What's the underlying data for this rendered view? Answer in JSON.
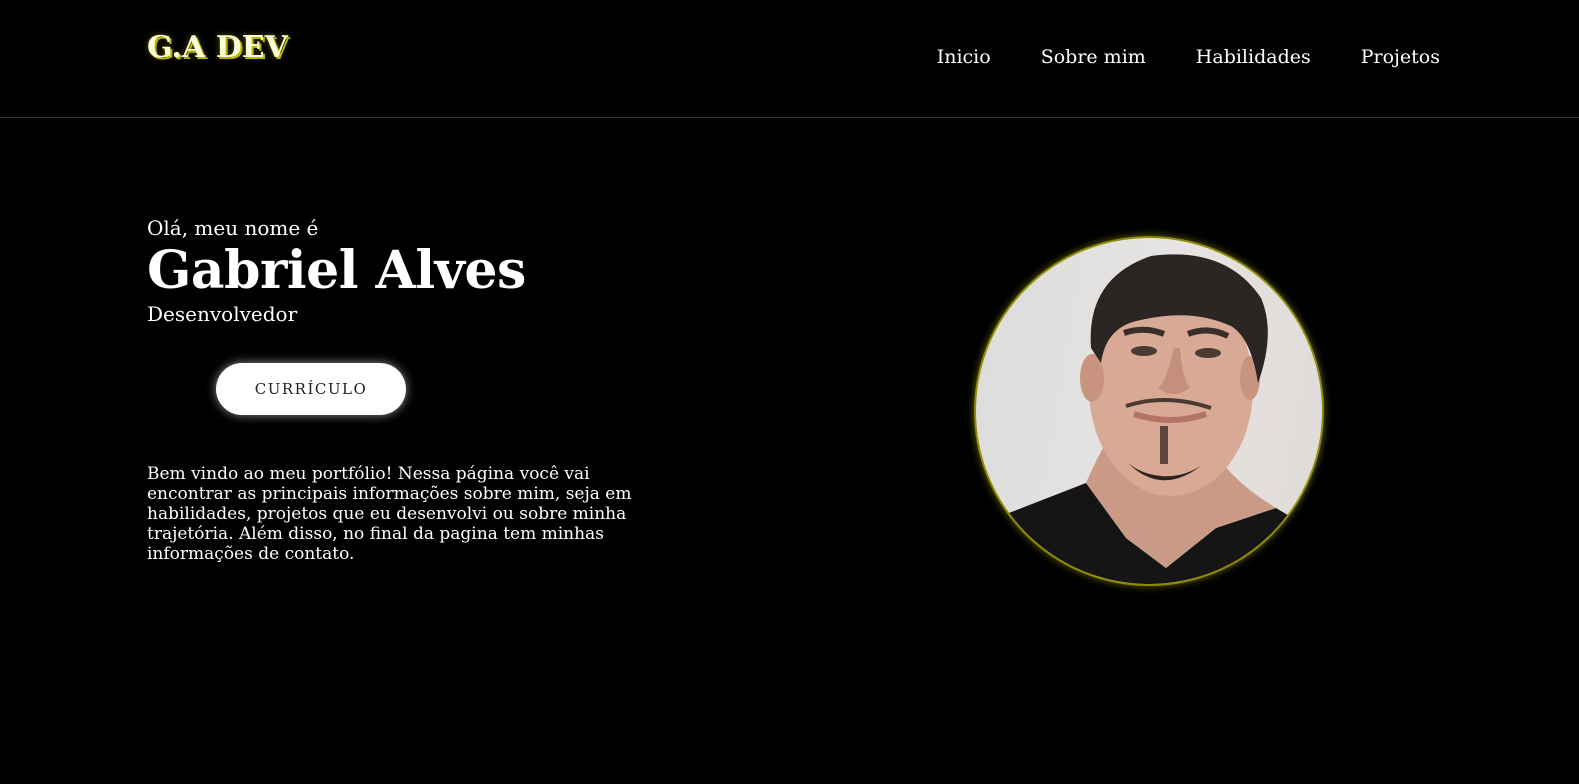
{
  "header": {
    "logo": "G.A DEV",
    "nav": [
      "Inicio",
      "Sobre mim",
      "Habilidades",
      "Projetos"
    ]
  },
  "hero": {
    "greeting": "Olá, meu nome é",
    "name": "Gabriel Alves",
    "role": "Desenvolvedor",
    "cv_button": "CURRÍCULO",
    "intro": "Bem vindo ao meu portfólio! Nessa página você vai encontrar as principais informações sobre mim, seja em habilidades, projetos que eu desenvolvi ou sobre minha trajetória. Além disso, no final da pagina tem minhas informações de contato."
  },
  "colors": {
    "background": "#000000",
    "accent": "#b9b400",
    "text": "#ffffff"
  }
}
